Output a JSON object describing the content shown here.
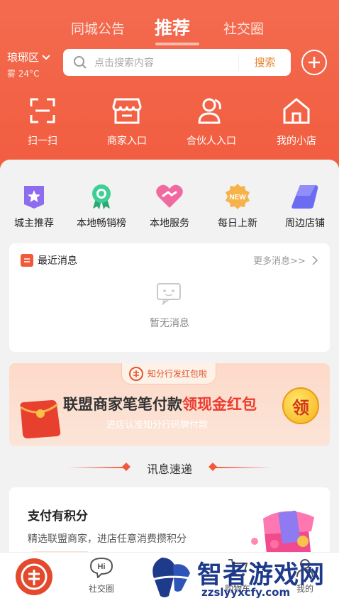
{
  "header": {
    "tabs": [
      "同城公告",
      "推荐",
      "社交圈"
    ],
    "active_tab": "推荐",
    "location": "琅琊区",
    "weather": "雾 24°C",
    "search": {
      "placeholder": "点击搜索内容",
      "button": "搜索"
    }
  },
  "quick_actions": [
    {
      "label": "扫一扫",
      "icon": "scan-icon"
    },
    {
      "label": "商家入口",
      "icon": "store-icon"
    },
    {
      "label": "合伙人入口",
      "icon": "partner-icon"
    },
    {
      "label": "我的小店",
      "icon": "home-icon"
    }
  ],
  "categories": [
    {
      "label": "城主推荐",
      "icon": "star-badge-icon",
      "color": "#8e6cf0"
    },
    {
      "label": "本地畅销榜",
      "icon": "award-icon",
      "color": "#36c28c"
    },
    {
      "label": "本地服务",
      "icon": "heart-handshake-icon",
      "color": "#f06aa0"
    },
    {
      "label": "每日上新",
      "icon": "new-badge-icon",
      "color": "#f6a93b",
      "badge": "NEW"
    },
    {
      "label": "周边店铺",
      "icon": "tag-icon",
      "color": "#6c6cf2"
    }
  ],
  "messages": {
    "title": "最近消息",
    "more": "更多消息>>",
    "empty": "暂无消息"
  },
  "banner": {
    "chip": "知分行发红包啦",
    "main_prefix": "联盟商家笔笔付款",
    "main_highlight": "领现金红包",
    "sub": "进店认准知分行码牌付款",
    "coin": "领"
  },
  "section_title": "讯息速递",
  "pay_card": {
    "title": "支付有积分",
    "desc": "精选联盟商家，进店任意消费攒积分"
  },
  "tabbar": [
    {
      "label": "",
      "icon": "home-logo-icon"
    },
    {
      "label": "社交圈",
      "icon": "chat-hi-icon"
    },
    {
      "label": "购物车",
      "icon": "cart-icon"
    },
    {
      "label": "我的",
      "icon": "user-icon"
    }
  ],
  "watermark": {
    "text": "智者游戏网",
    "url": "zzslyyxcfy.com"
  },
  "colors": {
    "brand": "#f25c3f",
    "highlight": "#ec3b2f",
    "search_btn": "#e8862f"
  }
}
